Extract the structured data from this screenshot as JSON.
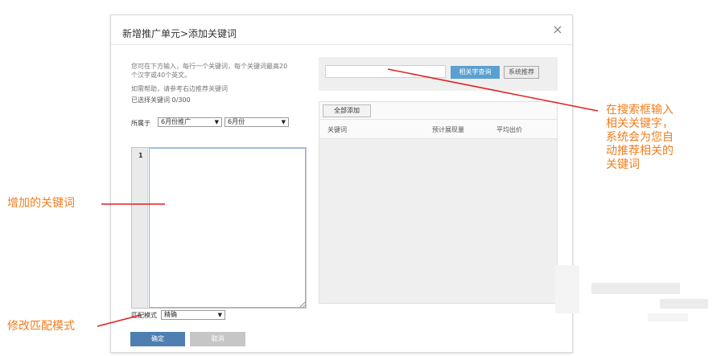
{
  "dialog": {
    "title": "新增推广单元>添加关键词",
    "close_glyph": "×"
  },
  "left": {
    "note_line1": "您可在下方输入，每行一个关键词，每个关键词最高20",
    "note_line2": "个汉字或40个英文。",
    "note_line3": "如需帮助，请参考右边推荐关键词",
    "selected_count": "已选择关键词 0/300",
    "belong_label": "所属于",
    "plan_select": "6月份推广",
    "unit_select": "6月份",
    "line_number": "1",
    "match_label": "匹配模式",
    "match_select": "精确",
    "confirm_label": "确定",
    "cancel_label": "取消"
  },
  "right": {
    "search_value": "",
    "query_button": "相关字查询",
    "recommend_button": "系统推荐",
    "add_all_button": "全部添加",
    "columns": [
      "关键词",
      "预计展现量",
      "平均出价"
    ]
  },
  "annotations": {
    "search_tip": [
      "在搜索框输入",
      "相关关键字，",
      "系统会为您自",
      "动推荐相关的",
      "关键词"
    ],
    "added_keywords": "增加的关键词",
    "match_tip": "修改匹配模式",
    "color": "#f07d1e",
    "line_color": "#e02020"
  }
}
